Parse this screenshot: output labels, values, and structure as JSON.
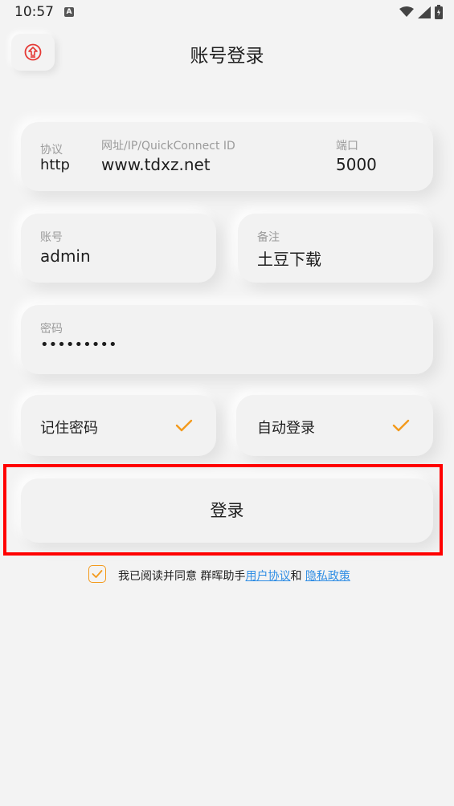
{
  "status_bar": {
    "time": "10:57",
    "notification_badge": "A"
  },
  "header": {
    "title": "账号登录",
    "back_icon": "home-up-icon"
  },
  "server": {
    "protocol_label": "协议",
    "protocol_value": "http",
    "address_label": "网址/IP/QuickConnect ID",
    "address_value": "www.tdxz.net",
    "port_label": "端口",
    "port_value": "5000"
  },
  "account": {
    "username_label": "账号",
    "username_value": "admin",
    "note_label": "备注",
    "note_value": "土豆下载",
    "password_label": "密码",
    "password_value": "•••••••••"
  },
  "options": {
    "remember_label": "记住密码",
    "remember_checked": true,
    "auto_login_label": "自动登录",
    "auto_login_checked": true
  },
  "login_button": {
    "label": "登录"
  },
  "agreement": {
    "checked": true,
    "prefix": "我已阅读并同意 群晖助手",
    "user_agreement": "用户协议",
    "and": "和 ",
    "privacy_policy": "隐私政策"
  },
  "colors": {
    "accent": "#f39a1c",
    "link": "#2f8de4",
    "highlight": "#ff0000",
    "back_icon": "#e53935"
  }
}
